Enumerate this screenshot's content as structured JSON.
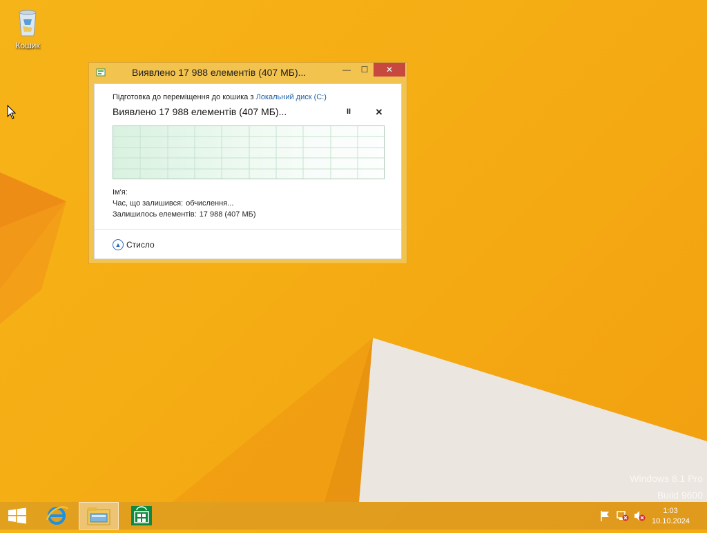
{
  "desktop": {
    "recycle_bin_label": "Кошик",
    "watermark": {
      "line1": "Windows 8.1 Pro",
      "line2": "Build 9600"
    }
  },
  "dialog": {
    "title": "Виявлено 17 988 елементів (407 МБ)...",
    "preparing_text": "Підготовка до переміщення до кошика з",
    "source_link": "Локальний диск (C:)",
    "headline": "Виявлено 17 988 елементів (407 МБ)...",
    "pause_glyph": "II",
    "cancel_glyph": "✕",
    "details": {
      "name_label": "Ім'я:",
      "time_label": "Час, що залишився:",
      "time_value": "обчислення...",
      "items_label": "Залишилось елементів:",
      "items_value": "17 988 (407 МБ)"
    },
    "less_details_label": "Стисло",
    "window_buttons": {
      "minimize": "—",
      "maximize": "☐",
      "close": "✕"
    },
    "progress": 0
  },
  "taskbar": {
    "items": [
      {
        "name": "start",
        "icon": "windows-logo-icon"
      },
      {
        "name": "internet-explorer",
        "icon": "internet-explorer-icon"
      },
      {
        "name": "file-explorer",
        "icon": "file-explorer-icon",
        "active": true
      },
      {
        "name": "store",
        "icon": "store-icon"
      }
    ],
    "tray": [
      "action-center-flag-icon",
      "network-error-icon",
      "volume-muted-icon"
    ],
    "clock": {
      "time": "1:03",
      "date": "10.10.2024"
    }
  },
  "colors": {
    "wallpaper": "#f5ad14",
    "dialog_frame": "#f3c350",
    "close_button": "#c7483f",
    "link": "#1c5fa8",
    "graph_fill": "#d9f1e0"
  }
}
